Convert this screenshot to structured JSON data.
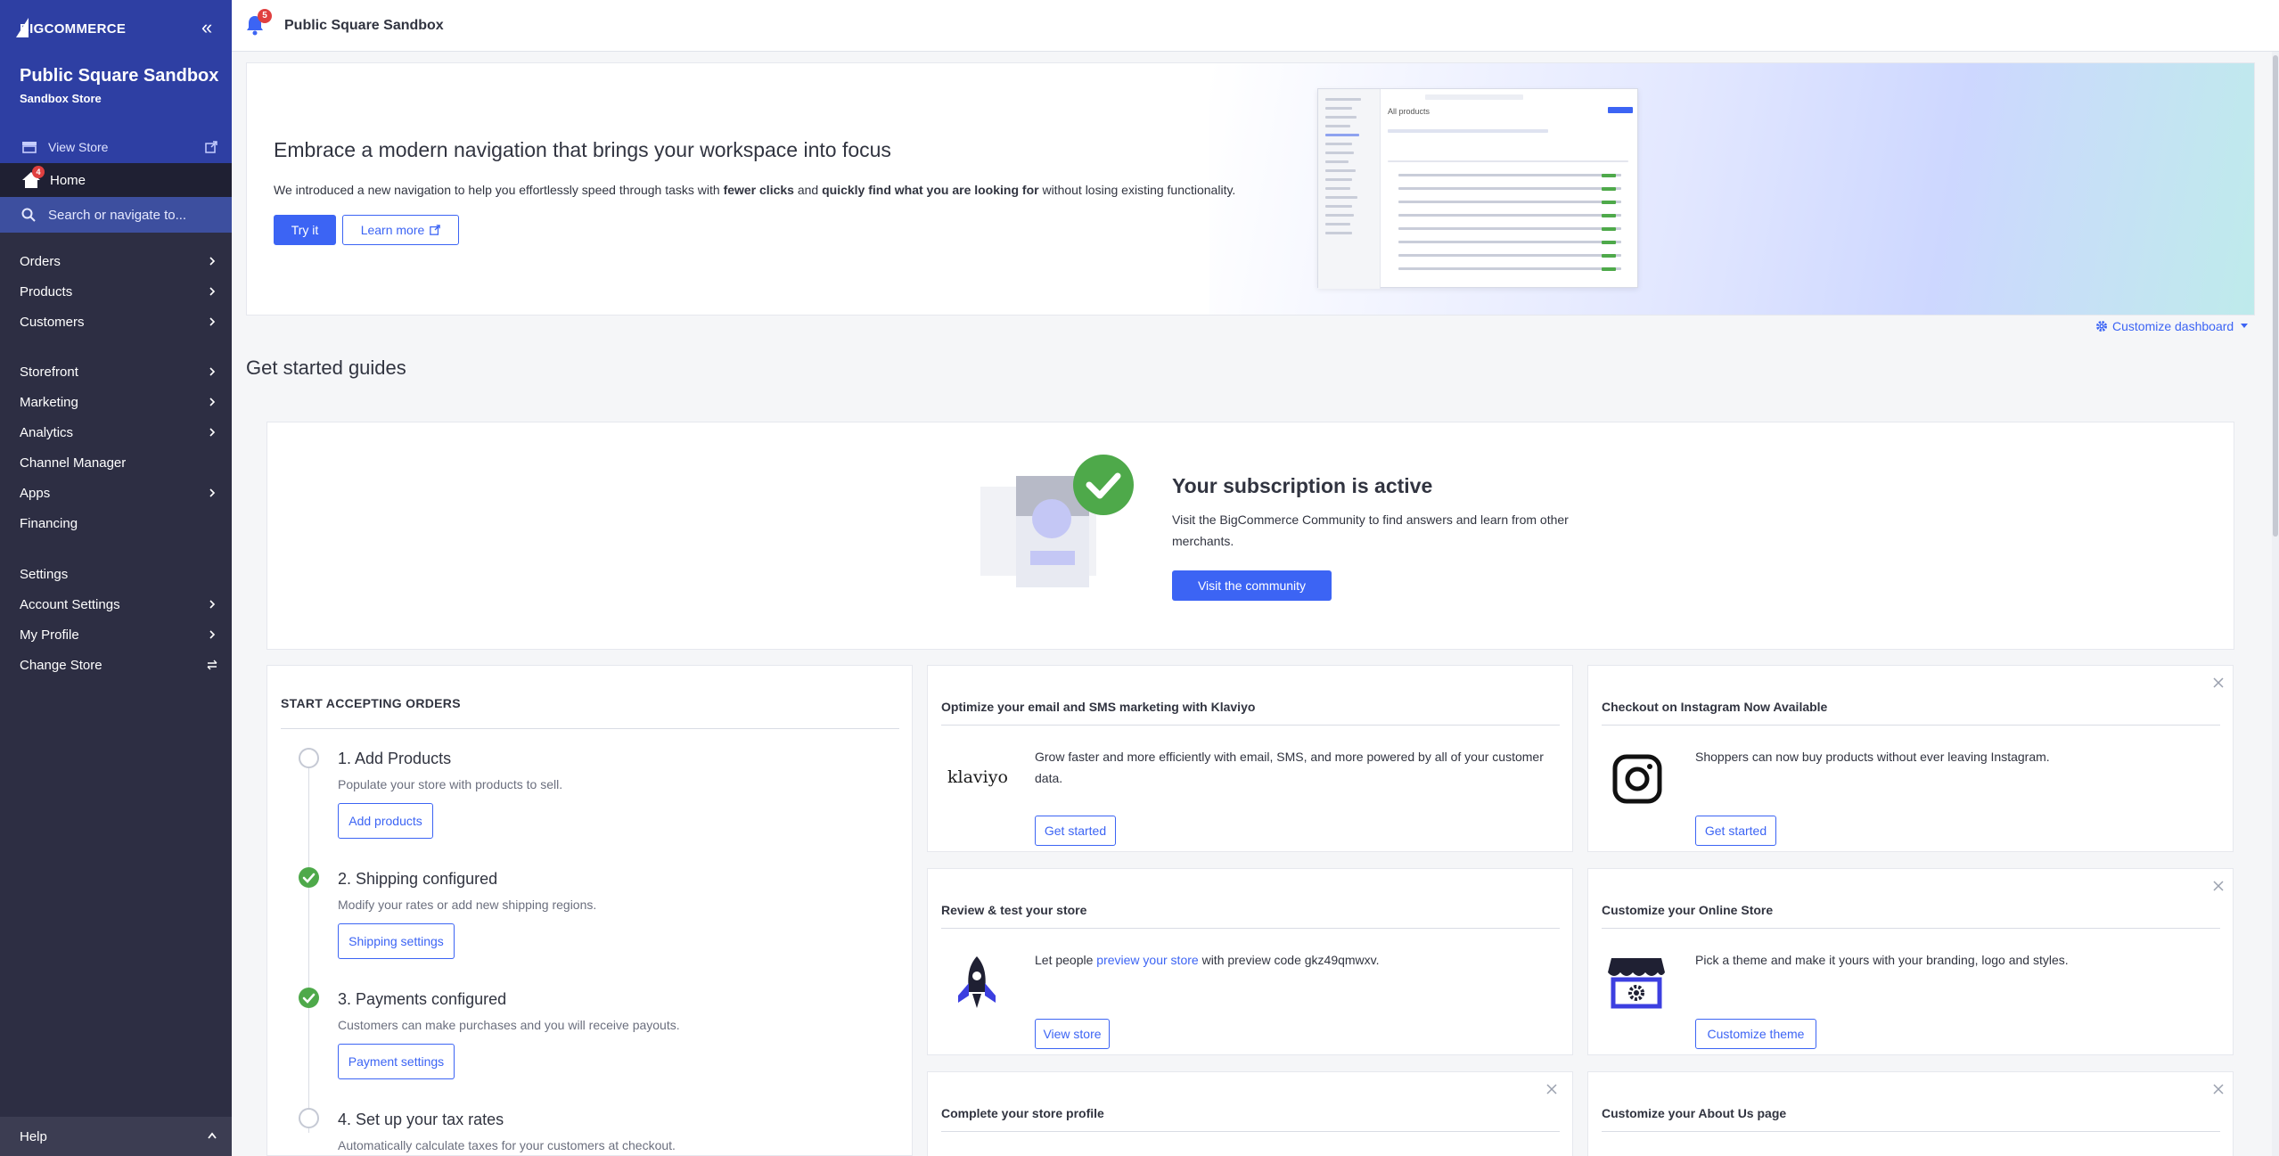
{
  "brand": {
    "logo_text": "BIGCOMMERCE"
  },
  "sidebar": {
    "store_name": "Public Square Sandbox",
    "store_sub": "Sandbox Store",
    "view_store": "View Store",
    "home": "Home",
    "home_badge": "4",
    "search_placeholder": "Search or navigate to...",
    "items": [
      {
        "label": "Orders"
      },
      {
        "label": "Products"
      },
      {
        "label": "Customers"
      },
      {
        "label": "Storefront"
      },
      {
        "label": "Marketing"
      },
      {
        "label": "Analytics"
      },
      {
        "label": "Channel Manager"
      },
      {
        "label": "Apps"
      },
      {
        "label": "Financing"
      },
      {
        "label": "Settings"
      },
      {
        "label": "Account Settings"
      },
      {
        "label": "My Profile"
      },
      {
        "label": "Change Store"
      }
    ],
    "help": "Help"
  },
  "topbar": {
    "title": "Public Square Sandbox",
    "bell_badge": "5"
  },
  "banner": {
    "title": "Embrace a modern navigation that brings your workspace into focus",
    "text_1": "We introduced a new navigation to help you effortlessly speed through tasks with ",
    "bold_1": "fewer clicks",
    "text_2": " and ",
    "bold_2": "quickly find what you are looking for",
    "text_3": " without losing existing functionality.",
    "try_it": "Try it",
    "learn_more": "Learn more",
    "mock_title": "All products"
  },
  "customize_dashboard": "Customize dashboard",
  "section_title": "Get started guides",
  "subscription": {
    "title": "Your subscription is active",
    "text": "Visit the BigCommerce Community to find answers and learn from other merchants.",
    "button": "Visit the community"
  },
  "orders": {
    "title": "START ACCEPTING ORDERS",
    "steps": [
      {
        "title": "1. Add Products",
        "desc": "Populate your store with products to sell.",
        "button": "Add products",
        "done": false
      },
      {
        "title": "2. Shipping configured",
        "desc": "Modify your rates or add new shipping regions.",
        "button": "Shipping settings",
        "done": true
      },
      {
        "title": "3. Payments configured",
        "desc": "Customers can make purchases and you will receive payouts.",
        "button": "Payment settings",
        "done": true
      },
      {
        "title": "4. Set up your tax rates",
        "desc": "Automatically calculate taxes for your customers at checkout.",
        "done": false
      }
    ]
  },
  "cards": {
    "klaviyo": {
      "title": "Optimize your email and SMS marketing with Klaviyo",
      "logo": "klaviyo",
      "text": "Grow faster and more efficiently with email, SMS, and more powered by all of your customer data.",
      "button": "Get started"
    },
    "instagram": {
      "title": "Checkout on Instagram Now Available",
      "text": "Shoppers can now buy products without ever leaving Instagram.",
      "button": "Get started"
    },
    "review": {
      "title": "Review & test your store",
      "text_1": "Let people ",
      "link": "preview your store",
      "text_2": " with preview code gkz49qmwxv.",
      "button": "View store"
    },
    "online_store": {
      "title": "Customize your Online Store",
      "text": "Pick a theme and make it yours with your branding, logo and styles.",
      "button": "Customize theme"
    },
    "profile": {
      "title": "Complete your store profile"
    },
    "about": {
      "title": "Customize your About Us page"
    }
  },
  "colors": {
    "sidebar": "#2d2e43",
    "sidebar_top": "#2e3fa3",
    "accent": "#3c64f4",
    "success": "#4ea94a",
    "badge": "#e04040"
  }
}
